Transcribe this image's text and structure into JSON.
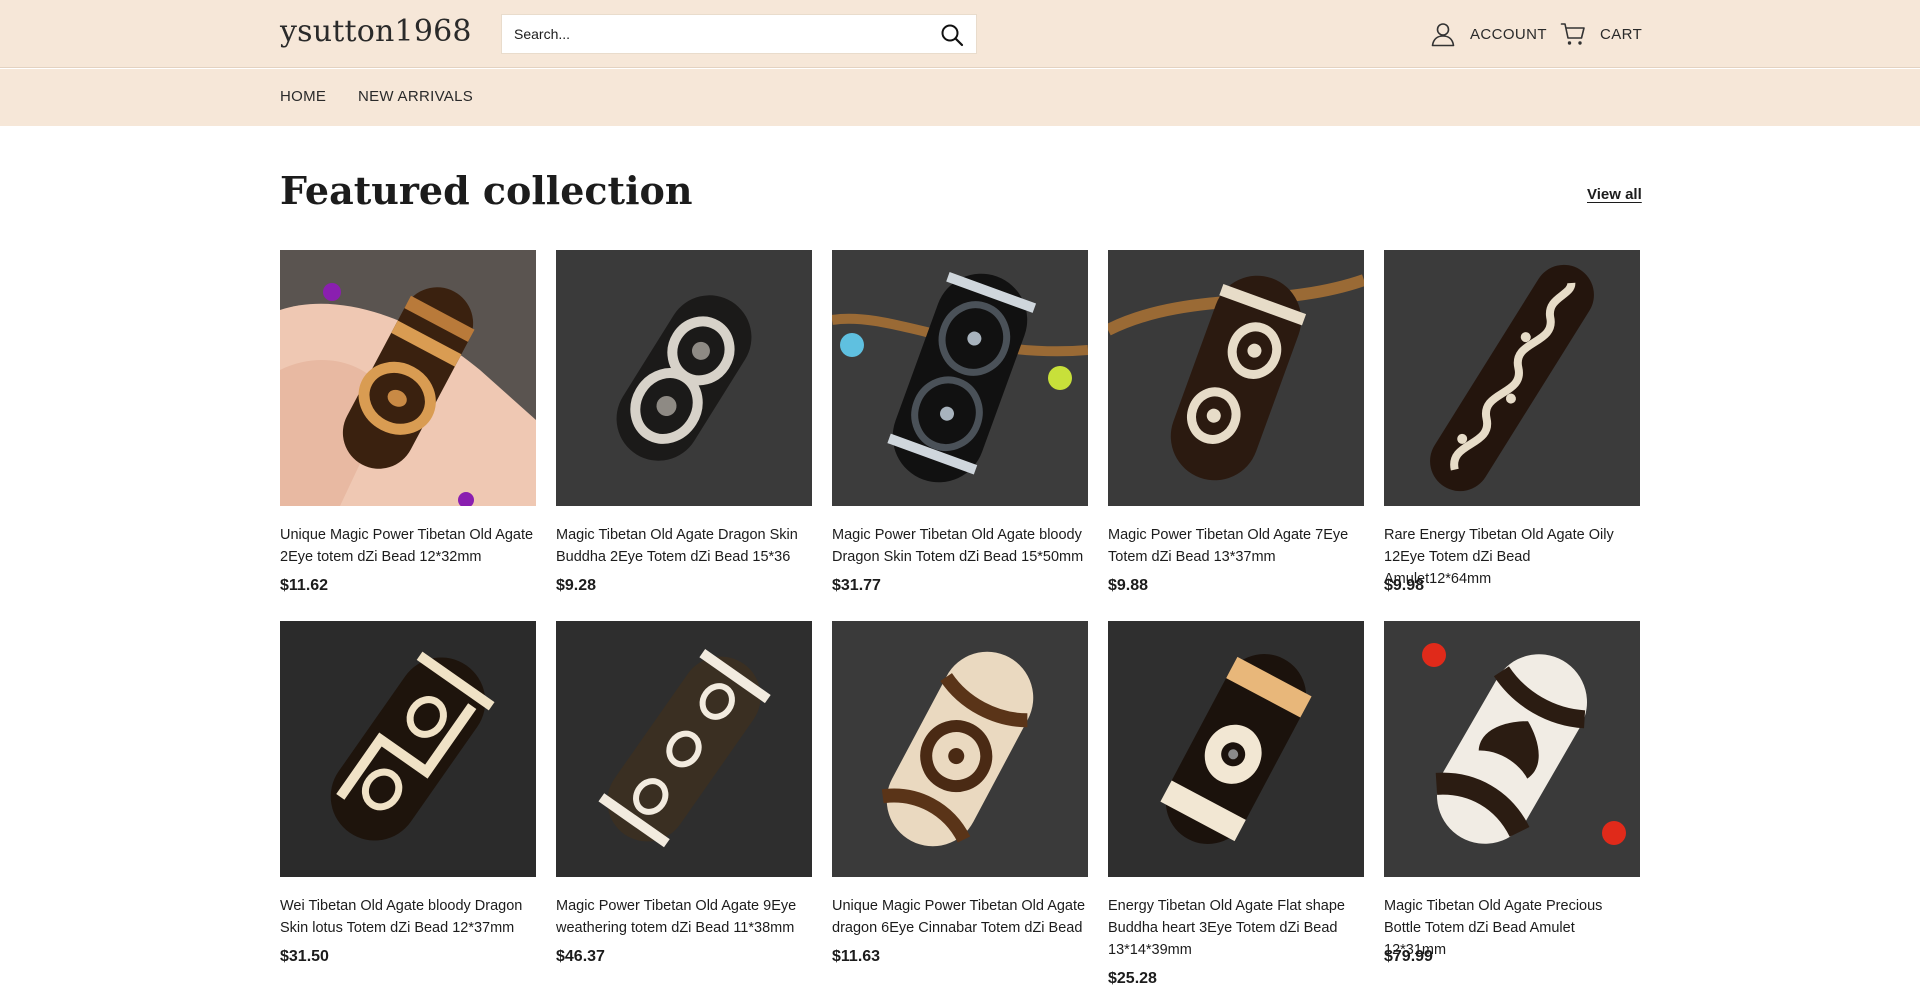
{
  "header": {
    "logo": "ysutton1968",
    "search_placeholder": "Search...",
    "account_label": "ACCOUNT",
    "cart_label": "CART"
  },
  "nav": {
    "items": [
      {
        "label": "HOME"
      },
      {
        "label": "NEW ARRIVALS"
      }
    ]
  },
  "main": {
    "section_title": "Featured collection",
    "view_all_label": "View all"
  },
  "colors": {
    "header_bg": "#f6e7d8",
    "text": "#1c1c1c"
  },
  "products": [
    {
      "title": "Unique Magic Power Tibetan Old Agate 2Eye totem dZi Bead 12*32mm",
      "price": "$11.62"
    },
    {
      "title": "Magic Tibetan Old Agate Dragon Skin Buddha 2Eye Totem dZi Bead 15*36",
      "price": "$9.28"
    },
    {
      "title": "Magic Power Tibetan Old Agate bloody Dragon Skin Totem dZi Bead 15*50mm",
      "price": "$31.77"
    },
    {
      "title": "Magic Power Tibetan Old Agate 7Eye Totem dZi Bead 13*37mm",
      "price": "$9.88"
    },
    {
      "title": "Rare Energy Tibetan Old Agate Oily 12Eye Totem dZi Bead Amulet12*64mm",
      "price": "$9.98"
    },
    {
      "title": "Wei Tibetan Old Agate bloody Dragon Skin lotus Totem dZi Bead 12*37mm",
      "price": "$31.50"
    },
    {
      "title": "Magic Power Tibetan Old Agate 9Eye weathering totem dZi Bead 11*38mm",
      "price": "$46.37"
    },
    {
      "title": "Unique Magic Power Tibetan Old Agate dragon 6Eye Cinnabar Totem dZi Bead",
      "price": "$11.63"
    },
    {
      "title": "Energy Tibetan Old Agate Flat shape Buddha heart 3Eye Totem dZi Bead 13*14*39mm",
      "price": "$25.28"
    },
    {
      "title": "Magic Tibetan Old Agate Precious Bottle Totem dZi Bead Amulet 12*31mm",
      "price": "$79.99"
    }
  ]
}
